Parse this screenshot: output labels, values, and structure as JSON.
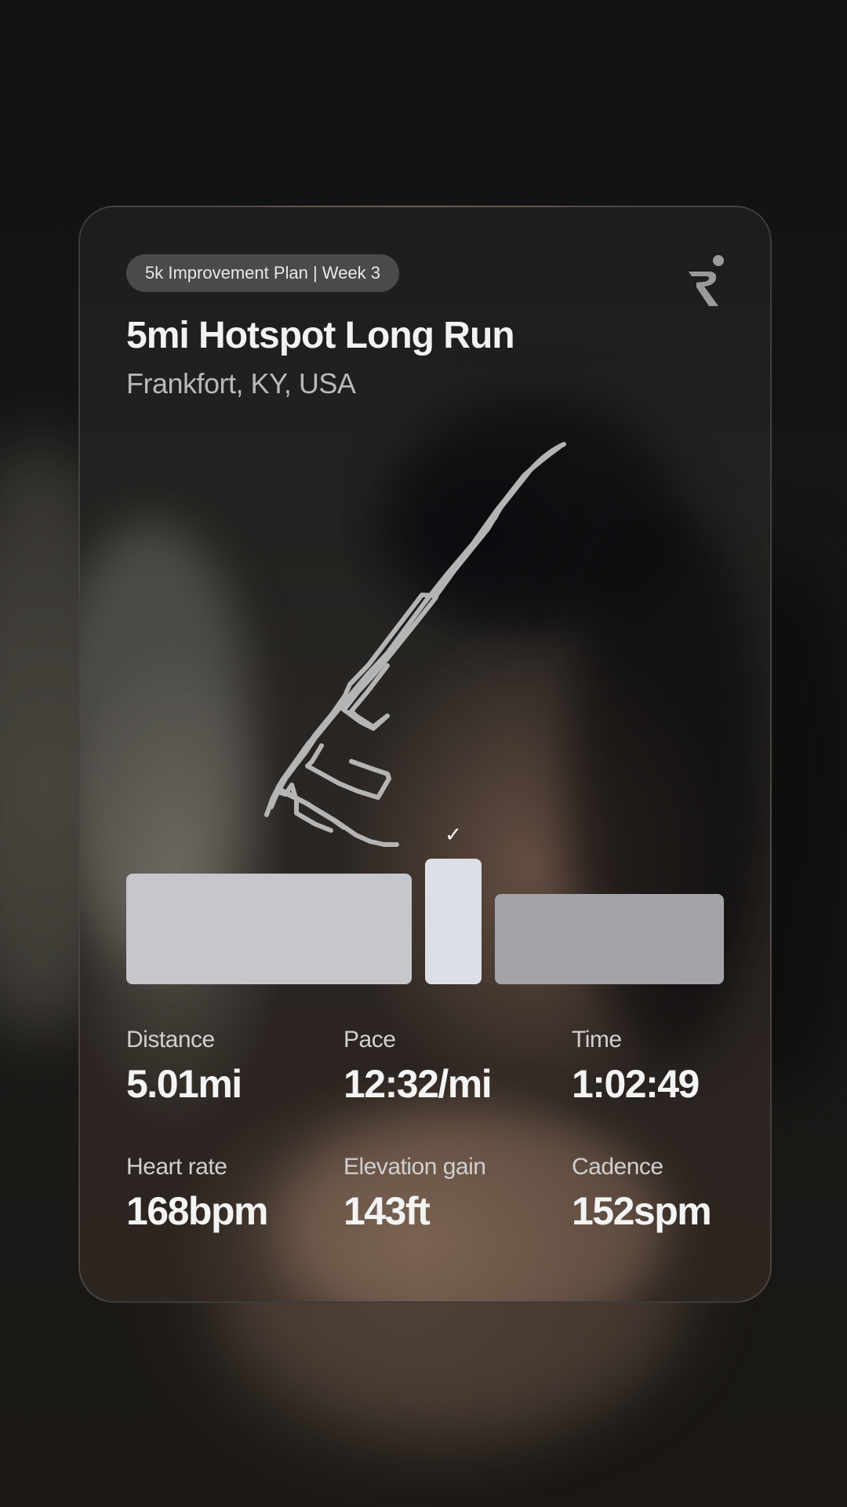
{
  "card": {
    "badge": "5k Improvement Plan | Week 3",
    "title": "5mi Hotspot Long Run",
    "location": "Frankfort, KY, USA",
    "logo_icon": "runna-logo-icon"
  },
  "splits": {
    "bars": [
      {
        "name": "split-bar-1",
        "relative_value": 0.88,
        "color": "#c6c7cc"
      },
      {
        "name": "split-bar-2",
        "relative_value": 1.0,
        "color": "#dcdfe6",
        "selected": true
      },
      {
        "name": "split-bar-3",
        "relative_value": 0.72,
        "color": "#a4a4a8"
      }
    ],
    "check_icon": "checkmark-icon"
  },
  "stats": [
    {
      "label": "Distance",
      "value": "5.01mi"
    },
    {
      "label": "Pace",
      "value": "12:32/mi"
    },
    {
      "label": "Time",
      "value": "1:02:49"
    },
    {
      "label": "Heart rate",
      "value": "168bpm"
    },
    {
      "label": "Elevation gain",
      "value": "143ft"
    },
    {
      "label": "Cadence",
      "value": "152spm"
    }
  ],
  "colors": {
    "background": "#0d0d0d",
    "card_border": "#3a3a3a",
    "route_line": "#bdbdbd",
    "text_primary": "#f4f4f4",
    "text_secondary": "#b9b9b9"
  }
}
